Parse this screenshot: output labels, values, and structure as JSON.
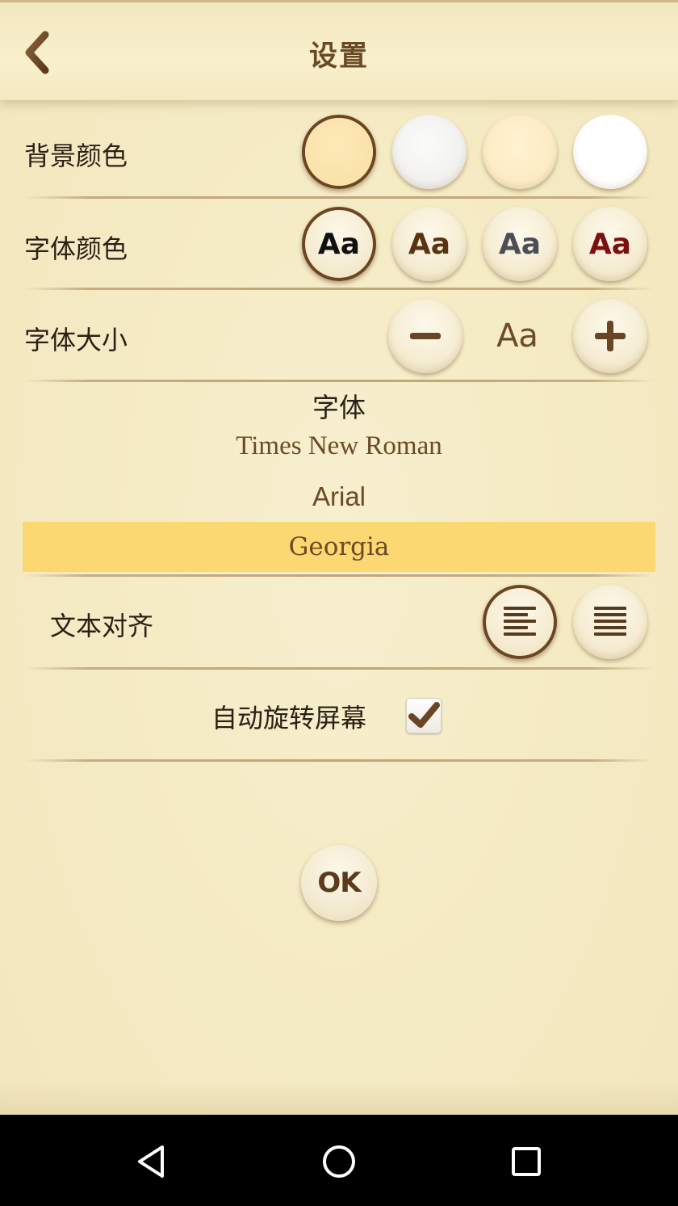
{
  "header": {
    "title": "设置",
    "back_icon": "arrow-left-icon"
  },
  "background_color": {
    "label": "背景颜色",
    "options": [
      {
        "name": "parchment",
        "color": "#fbe6b2",
        "selected": true
      },
      {
        "name": "light-gray",
        "color": "#f1f0ee",
        "selected": false
      },
      {
        "name": "cream",
        "color": "#fcedc6",
        "selected": false
      },
      {
        "name": "white",
        "color": "#ffffff",
        "selected": false
      }
    ]
  },
  "font_color": {
    "label": "字体颜色",
    "sample": "Aa",
    "options": [
      {
        "name": "black",
        "color": "#111111",
        "selected": true
      },
      {
        "name": "brown",
        "color": "#5a3310",
        "selected": false
      },
      {
        "name": "gray",
        "color": "#4b4e55",
        "selected": false
      },
      {
        "name": "dark-red",
        "color": "#7a1010",
        "selected": false
      }
    ]
  },
  "font_size": {
    "label": "字体大小",
    "sample": "Aa",
    "decrease_icon": "minus-icon",
    "increase_icon": "plus-icon"
  },
  "font_family": {
    "title": "字体",
    "options": [
      {
        "label": "Times New Roman",
        "selected": false
      },
      {
        "label": "Arial",
        "selected": false
      },
      {
        "label": "Georgia",
        "selected": true
      }
    ]
  },
  "text_align": {
    "label": "文本对齐",
    "options": [
      {
        "name": "align-left",
        "icon": "align-left-icon",
        "selected": true
      },
      {
        "name": "justify",
        "icon": "align-justify-icon",
        "selected": false
      }
    ]
  },
  "auto_rotate": {
    "label": "自动旋转屏幕",
    "checked": true
  },
  "ok_button": {
    "label": "OK"
  },
  "navbar": {
    "back_icon": "triangle-back-icon",
    "home_icon": "circle-home-icon",
    "recents_icon": "square-recents-icon"
  },
  "colors": {
    "accent_brown": "#6e4522",
    "selected_highlight": "#fbd872"
  }
}
